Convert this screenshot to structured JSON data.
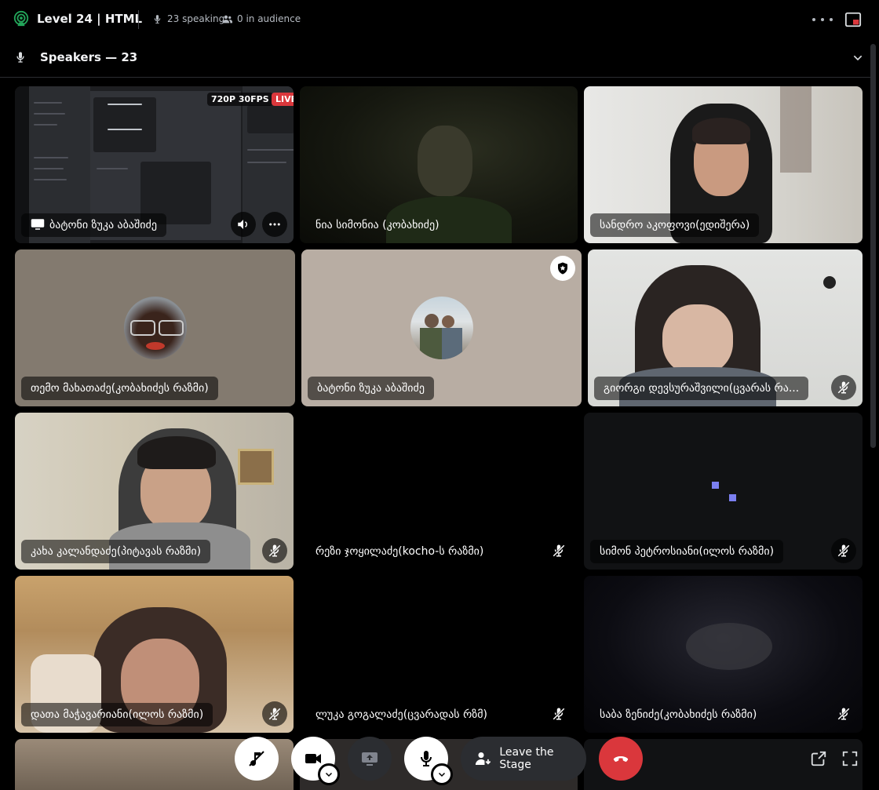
{
  "header": {
    "title": "Level 24 | HTML",
    "speaking": "23 speaking",
    "audience": "0 in audience"
  },
  "speakers_section": {
    "label": "Speakers — 23"
  },
  "screenshare": {
    "resolution": "720P 30FPS",
    "live": "LIVE",
    "name": "ბატონი ზუკა აბაშიძე"
  },
  "tiles": [
    {
      "name": "ნია სიმონია (კობახიძე)"
    },
    {
      "name": "სანდრო აკოფოვი(ედიშერა)"
    },
    {
      "name": "თემო მახათაძე(კობახიძეს რაზმი)"
    },
    {
      "name": "ბატონი ზუკა აბაშიძე"
    },
    {
      "name": "გიორგი დევსურაშვილი(ცვარას რა..."
    },
    {
      "name": "კახა კალანდაძე(პიტავას რაზმი)"
    },
    {
      "name": "რეზი ჯოყილაძე(kocho-ს რაზმი)"
    },
    {
      "name": "სიმონ პეტროსიანი(ილოს რაზმი)"
    },
    {
      "name": "დათა მაჭავარიანი(ილოს რაზმი)"
    },
    {
      "name": "ლუკა გოგალაძე(ცვარადას რზმ)"
    },
    {
      "name": "საბა ზენიძე(კობახიძეს რაზმი)"
    }
  ],
  "controls": {
    "leave_label": "Leave the Stage"
  },
  "colors": {
    "background": "#000000",
    "tile_warm_gray": "#837a6f",
    "tile_beige": "#b8ada3",
    "end_call_red": "#da373c",
    "live_red": "#da373c"
  },
  "icons": [
    "stage-icon",
    "microphone-icon",
    "people-icon",
    "more-icon",
    "popout-icon",
    "chevron-down-icon",
    "screen-icon",
    "volume-icon",
    "muted-mic-icon",
    "moderator-icon",
    "sound-muted-icon",
    "camera-icon",
    "screenshare-icon",
    "leave-icon",
    "end-call-icon",
    "open-external-icon",
    "fullscreen-icon"
  ]
}
